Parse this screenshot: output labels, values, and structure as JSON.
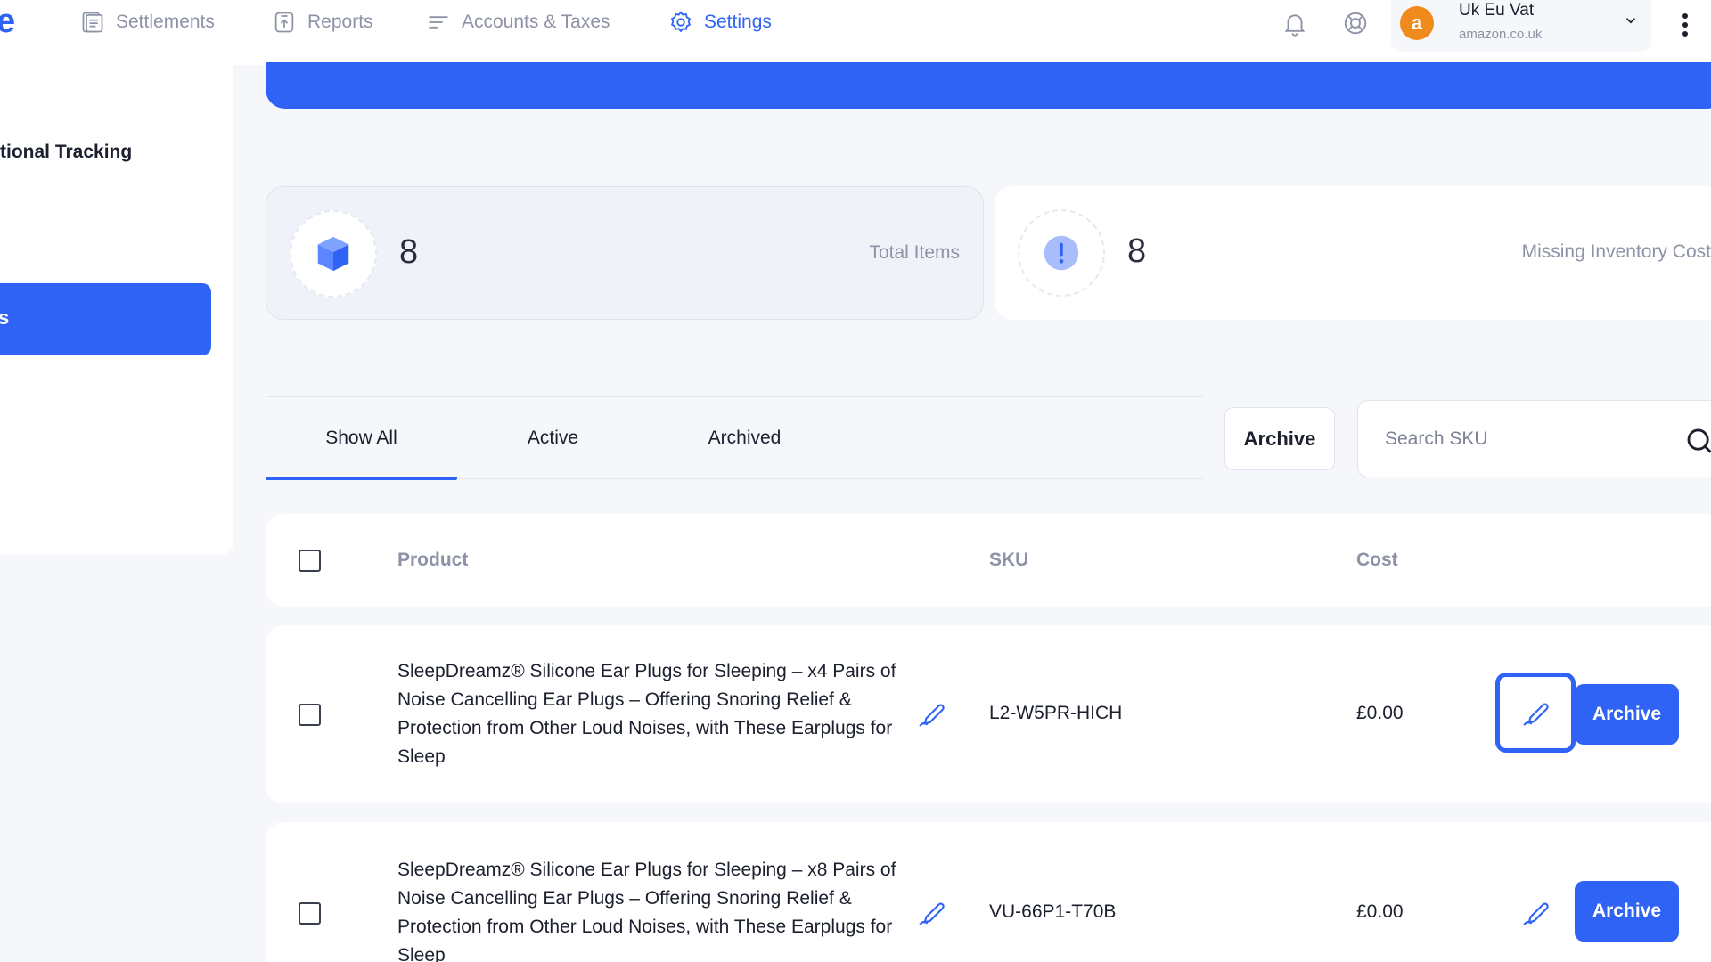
{
  "nav": {
    "logo_fragment": "e",
    "items": [
      {
        "label": "Settlements",
        "icon": "document-icon"
      },
      {
        "label": "Reports",
        "icon": "report-icon"
      },
      {
        "label": "Accounts & Taxes",
        "icon": "list-icon"
      },
      {
        "label": "Settings",
        "icon": "gear-icon",
        "active": true
      }
    ],
    "account": {
      "name": "Uk Eu Vat",
      "domain": "amazon.co.uk",
      "badge": "a"
    }
  },
  "sidebar": {
    "tracking_label": "tional Tracking",
    "active_item_label": "s"
  },
  "stats": {
    "total_items": {
      "value": "8",
      "label": "Total Items"
    },
    "missing_cost": {
      "value": "8",
      "label": "Missing Inventory Cost"
    }
  },
  "tabs": [
    "Show All",
    "Active",
    "Archived"
  ],
  "toolbar": {
    "archive_label": "Archive",
    "search_placeholder": "Search SKU"
  },
  "table": {
    "headers": {
      "product": "Product",
      "sku": "SKU",
      "cost": "Cost"
    },
    "rows": [
      {
        "product": "SleepDreamz® Silicone Ear Plugs for Sleeping – x4 Pairs of Noise Cancelling Ear Plugs – Offering Snoring Relief & Protection from Other Loud Noises, with These Earplugs for Sleep",
        "sku": "L2-W5PR-HICH",
        "cost": "£0.00",
        "action": "Archive"
      },
      {
        "product": "SleepDreamz® Silicone Ear Plugs for Sleeping – x8 Pairs of Noise Cancelling Ear Plugs – Offering Snoring Relief & Protection from Other Loud Noises, with These Earplugs for Sleep",
        "sku": "VU-66P1-T70B",
        "cost": "£0.00",
        "action": "Archive"
      }
    ]
  },
  "colors": {
    "accent": "#2f63f5",
    "amazon": "#f08a1c",
    "muted": "#8d92a6"
  }
}
